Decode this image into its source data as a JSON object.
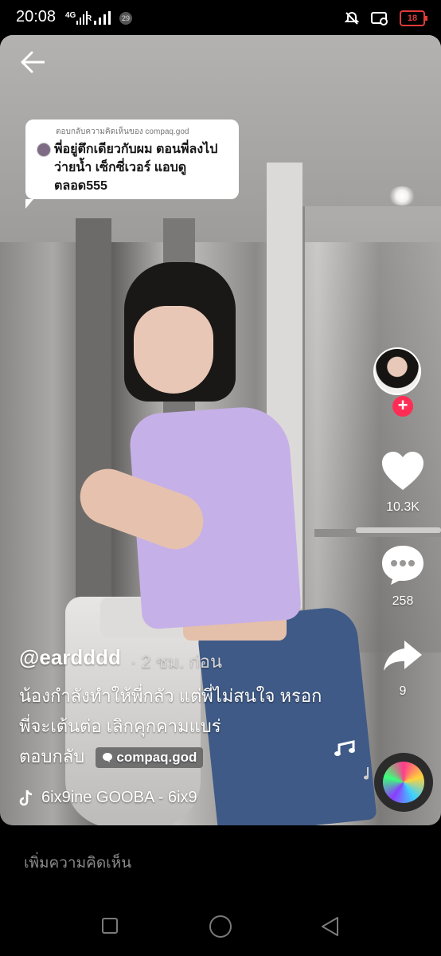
{
  "status_bar": {
    "time": "20:08",
    "network": "4G",
    "roaming": "R",
    "notification_count": "29",
    "battery": "18"
  },
  "reply_card": {
    "header": "ตอบกลับความคิดเห็นของ compaq.god",
    "text": "พี่อยู่ตึกเดียวกับผม ตอนพี่ลงไปว่ายน้ำ เซ็กซี่เวอร์ แอบดูตลอด555"
  },
  "right_rail": {
    "likes": "10.3K",
    "comments": "258",
    "shares": "9"
  },
  "post": {
    "username": "@eardddd",
    "posted_ago": "· 2 ชม. ก่อน",
    "caption": "น้องกำลังทำให้พี่กลัว แต่พี่ไม่สนใจ หรอก พี่จะเต้นต่อ เลิกคุกคามแบร่",
    "reply_label": "ตอบกลับ",
    "reply_to": "compaq.god",
    "music": "6ix9ine    GOOBA - 6ix9"
  },
  "comment_bar": {
    "placeholder": "เพิ่มความคิดเห็น"
  },
  "colors": {
    "accent_follow": "#ff2d55",
    "battery_low": "#e23b3b"
  },
  "icons": {
    "back": "back-arrow-icon",
    "like": "heart-icon",
    "comment": "comment-bubble-icon",
    "share": "share-arrow-icon",
    "music": "music-note-icon",
    "tiktok": "tiktok-logo-icon"
  }
}
